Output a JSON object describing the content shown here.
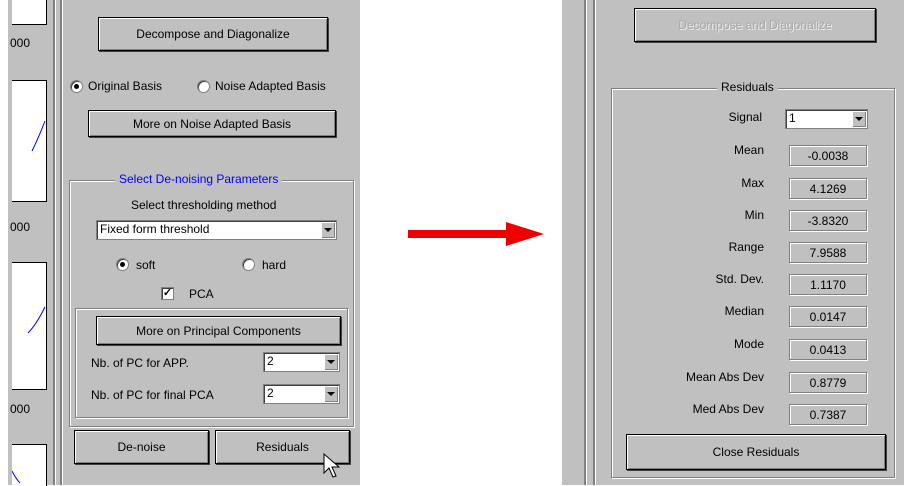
{
  "colors": {
    "panel_gray": "#c0c0c0",
    "frame_title_blue": "#0000ff",
    "arrow_red": "#ee0000",
    "plot_line_blue": "#0000ff",
    "disabled_text": "#a6a6a6"
  },
  "left_panel": {
    "axis_ticks": [
      "000",
      "000",
      "000"
    ],
    "decompose_button": "Decompose and Diagonalize",
    "basis": {
      "original": "Original Basis",
      "noise_adapted": "Noise Adapted Basis",
      "selected": "original"
    },
    "more_noise_button": "More on Noise Adapted Basis",
    "denoise_frame": {
      "title": "Select De-noising Parameters",
      "threshold_label": "Select thresholding method",
      "threshold_value": "Fixed form threshold",
      "soft_label": "soft",
      "hard_label": "hard",
      "selected_mode": "soft",
      "pca_label": "PCA",
      "pca_checked": true,
      "more_pc_button": "More on Principal Components",
      "pc_app_label": "Nb. of  PC for APP.",
      "pc_app_value": "2",
      "pc_final_label": "Nb. of PC for final PCA",
      "pc_final_value": "2"
    },
    "denoise_button": "De-noise",
    "residuals_button": "Residuals",
    "cursor_icon": "mouse-pointer-icon"
  },
  "arrow_icon": "right-arrow-icon",
  "right_panel": {
    "decompose_button": "Decompose and Diagonalize",
    "residuals_frame_title": "Residuals",
    "signal_label": "Signal",
    "signal_value": "1",
    "stats": [
      {
        "label": "Mean",
        "value": "-0.0038"
      },
      {
        "label": "Max",
        "value": "4.1269"
      },
      {
        "label": "Min",
        "value": "-3.8320"
      },
      {
        "label": "Range",
        "value": "7.9588"
      },
      {
        "label": "Std. Dev.",
        "value": "1.1170"
      },
      {
        "label": "Median",
        "value": "0.0147"
      },
      {
        "label": "Mode",
        "value": "0.0413"
      },
      {
        "label": "Mean Abs Dev",
        "value": "0.8779"
      },
      {
        "label": "Med Abs Dev",
        "value": "0.7387"
      }
    ],
    "close_button": "Close Residuals"
  }
}
